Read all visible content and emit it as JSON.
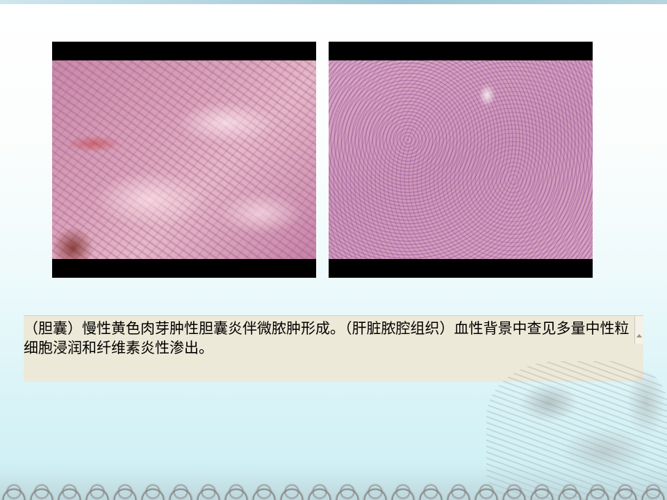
{
  "slide": {
    "caption": "（胆囊）慢性黄色肉芽肿性胆囊炎伴微脓肿形成。（肝脏脓腔组织）血性背景中查见多量中性粒细胞浸润和纤维素炎性渗出。"
  },
  "colors": {
    "caption_bg": "#ede9d8",
    "photo_frame": "#000000",
    "top_bar": "#9cc6d6"
  },
  "icons": {
    "scroll_up": "scroll-up-icon"
  }
}
